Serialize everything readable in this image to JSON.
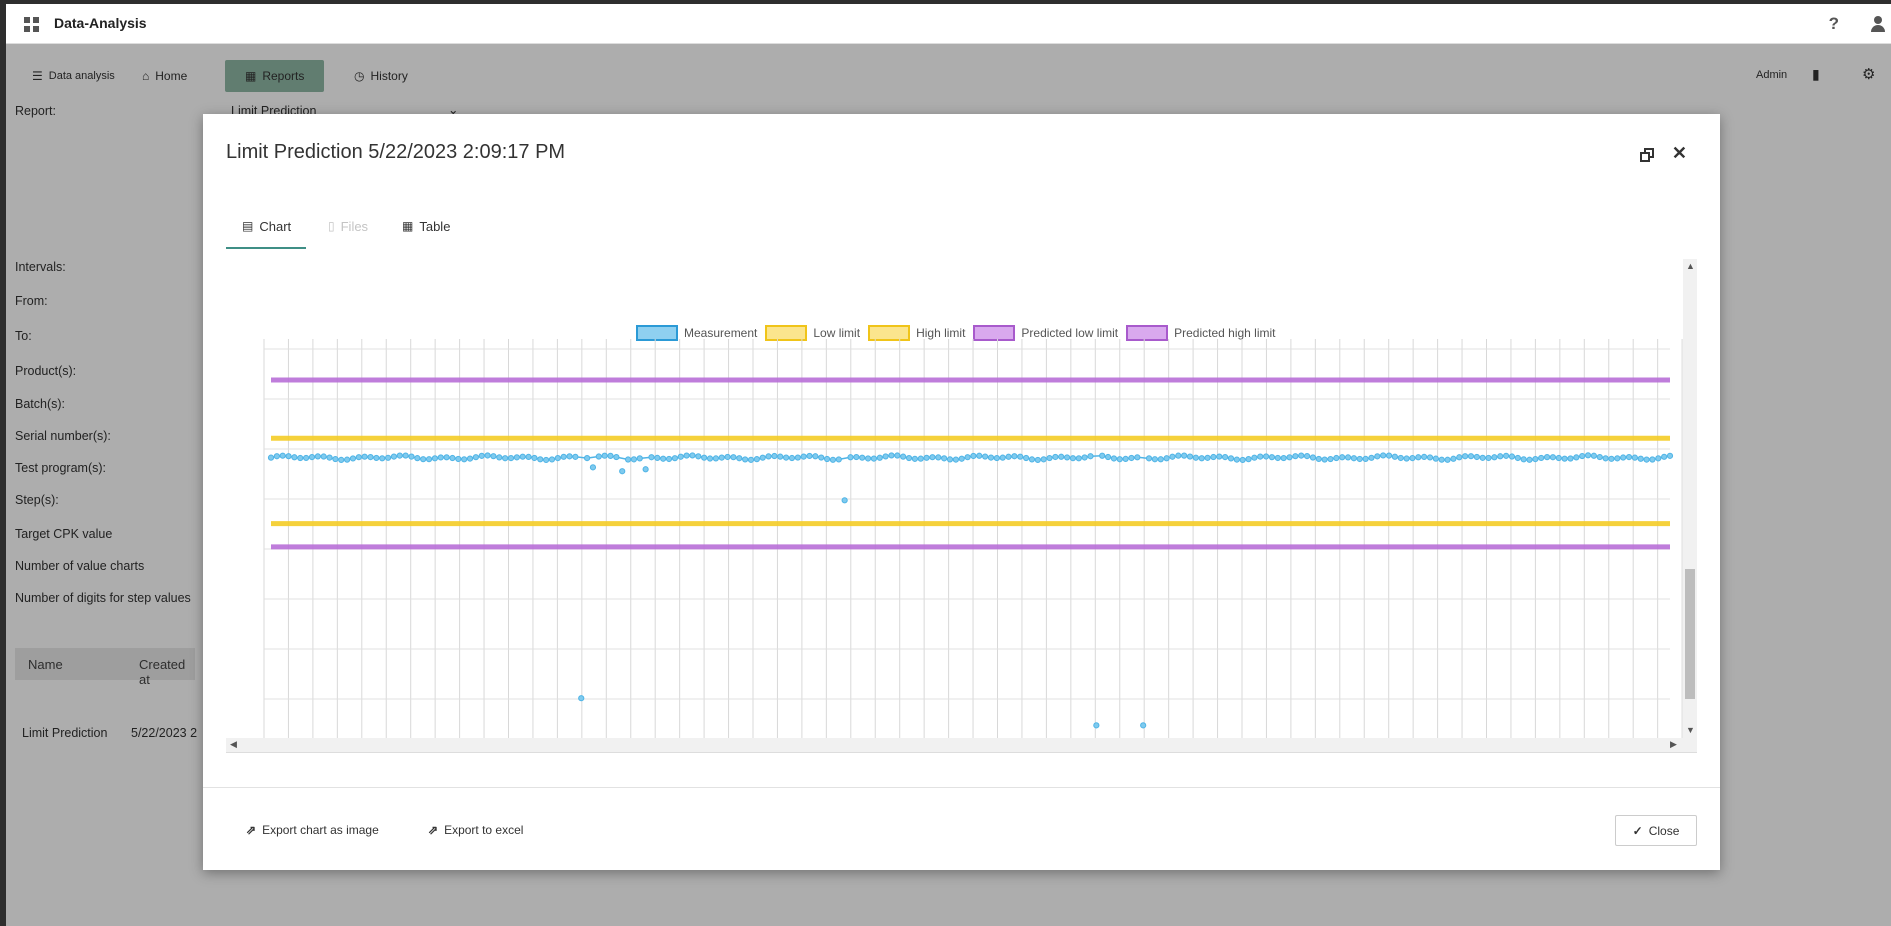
{
  "app": {
    "title": "Data-Analysis"
  },
  "icons": {
    "apps": "grid-icon",
    "help": "help-icon",
    "user": "user-icon"
  },
  "nav": {
    "items": [
      {
        "label": "Data analysis",
        "icon": "database-icon"
      },
      {
        "label": "Home",
        "icon": "home-icon"
      },
      {
        "label": "Reports",
        "icon": "report-icon"
      },
      {
        "label": "History",
        "icon": "history-icon"
      }
    ],
    "admin": "Admin",
    "accent_color": "#8fb8a6"
  },
  "form": {
    "report_label": "Report:",
    "report_value": "Limit Prediction",
    "labels": [
      "Intervals:",
      "From:",
      "To:",
      "Product(s):",
      "Batch(s):",
      "Serial number(s):",
      "Test program(s):",
      "Step(s):",
      "Target CPK value",
      "Number of value charts",
      "Number of digits for step values"
    ]
  },
  "results_table": {
    "headers": [
      "Name",
      "Created at"
    ],
    "row": [
      "Limit Prediction",
      "5/22/2023 2"
    ]
  },
  "modal": {
    "title": "Limit Prediction 5/22/2023 2:09:17 PM",
    "tabs": [
      {
        "label": "Chart",
        "state": "active",
        "icon": "chart-icon"
      },
      {
        "label": "Files",
        "state": "disabled",
        "icon": "file-icon"
      },
      {
        "label": "Table",
        "state": "normal",
        "icon": "table-icon"
      }
    ],
    "footer": {
      "export_image": "Export chart as image",
      "export_excel": "Export to excel",
      "close": "Close"
    }
  },
  "chart_data": {
    "type": "line",
    "legend": [
      "Measurement",
      "Low limit",
      "High limit",
      "Predicted low limit",
      "Predicted high limit"
    ],
    "legend_placement": "top",
    "colors": {
      "Measurement": "#4fb4e6",
      "Low limit": "#f5cd26",
      "High limit": "#f5cd26",
      "Predicted low limit": "#b96fd8",
      "Predicted high limit": "#b96fd8"
    },
    "grid": true,
    "x": {
      "count": 240
    },
    "ylim": [
      0,
      100
    ],
    "series": [
      {
        "name": "Predicted high limit",
        "constant": 92
      },
      {
        "name": "High limit",
        "constant": 77
      },
      {
        "name": "Low limit",
        "constant": 55
      },
      {
        "name": "Predicted low limit",
        "constant": 49
      },
      {
        "name": "Measurement",
        "base": 72,
        "outliers": [
          [
            53,
            10
          ],
          [
            98,
            61
          ],
          [
            141,
            3
          ],
          [
            149,
            3
          ],
          [
            60,
            68.5
          ],
          [
            64,
            69
          ],
          [
            55,
            69.5
          ]
        ]
      }
    ]
  }
}
